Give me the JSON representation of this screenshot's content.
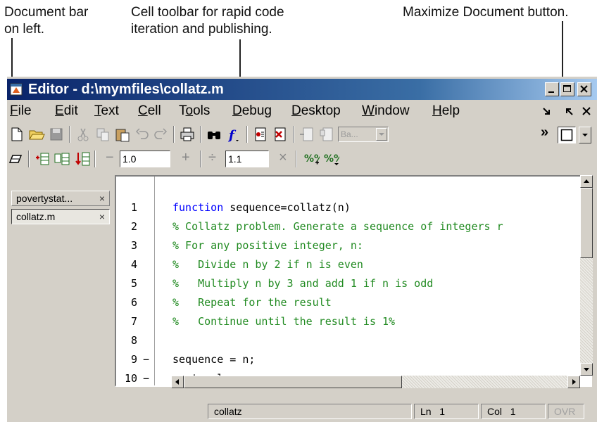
{
  "annotations": {
    "docbar_line1": "Document bar",
    "docbar_line2": "on left.",
    "celltoolbar_line1": "Cell toolbar for rapid code",
    "celltoolbar_line2": "iteration and publishing.",
    "maximize": "Maximize Document button."
  },
  "window": {
    "title": "Editor - d:\\mymfiles\\collatz.m"
  },
  "menu": {
    "items": [
      {
        "accel": "F",
        "rest": "ile"
      },
      {
        "accel": "E",
        "rest": "dit"
      },
      {
        "accel": "T",
        "rest": "ext"
      },
      {
        "accel": "C",
        "rest": "ell"
      },
      {
        "pre": "T",
        "accel": "o",
        "rest": "ols"
      },
      {
        "accel": "D",
        "rest": "ebug"
      },
      {
        "accel": "D",
        "rest": "esktop"
      },
      {
        "accel": "W",
        "rest": "indow"
      },
      {
        "accel": "H",
        "rest": "elp"
      }
    ]
  },
  "toolbar": {
    "stack_combo": "Ba...",
    "overflow": "»"
  },
  "celltoolbar": {
    "minus": "−",
    "plus": "+",
    "divide": "÷",
    "times": "×",
    "value1": "1.0",
    "value2": "1.1"
  },
  "docbar": {
    "tabs": [
      {
        "label": "povertystat...",
        "close": "×"
      },
      {
        "label": "collatz.m",
        "close": "×"
      }
    ]
  },
  "editor": {
    "lines": [
      {
        "num": "1",
        "bp": "",
        "kw": "function",
        "text": " sequence=collatz(n)",
        "type": "code"
      },
      {
        "num": "2",
        "bp": "",
        "text": "% Collatz problem. Generate a sequence of integers r",
        "type": "comment"
      },
      {
        "num": "3",
        "bp": "",
        "text": "% For any positive integer, n:",
        "type": "comment"
      },
      {
        "num": "4",
        "bp": "",
        "text": "%   Divide n by 2 if n is even",
        "type": "comment"
      },
      {
        "num": "5",
        "bp": "",
        "text": "%   Multiply n by 3 and add 1 if n is odd",
        "type": "comment"
      },
      {
        "num": "6",
        "bp": "",
        "text": "%   Repeat for the result",
        "type": "comment"
      },
      {
        "num": "7",
        "bp": "",
        "text": "%   Continue until the result is 1%",
        "type": "comment"
      },
      {
        "num": "8",
        "bp": "",
        "text": "",
        "type": "code"
      },
      {
        "num": "9",
        "bp": "−",
        "text": "sequence = n;",
        "type": "code"
      },
      {
        "num": "10",
        "bp": "−",
        "text": "next_value = n;",
        "type": "code"
      }
    ]
  },
  "status": {
    "function_name": "collatz",
    "ln_label": "Ln",
    "ln_value": "1",
    "col_label": "Col",
    "col_value": "1",
    "ovr": "OVR"
  }
}
